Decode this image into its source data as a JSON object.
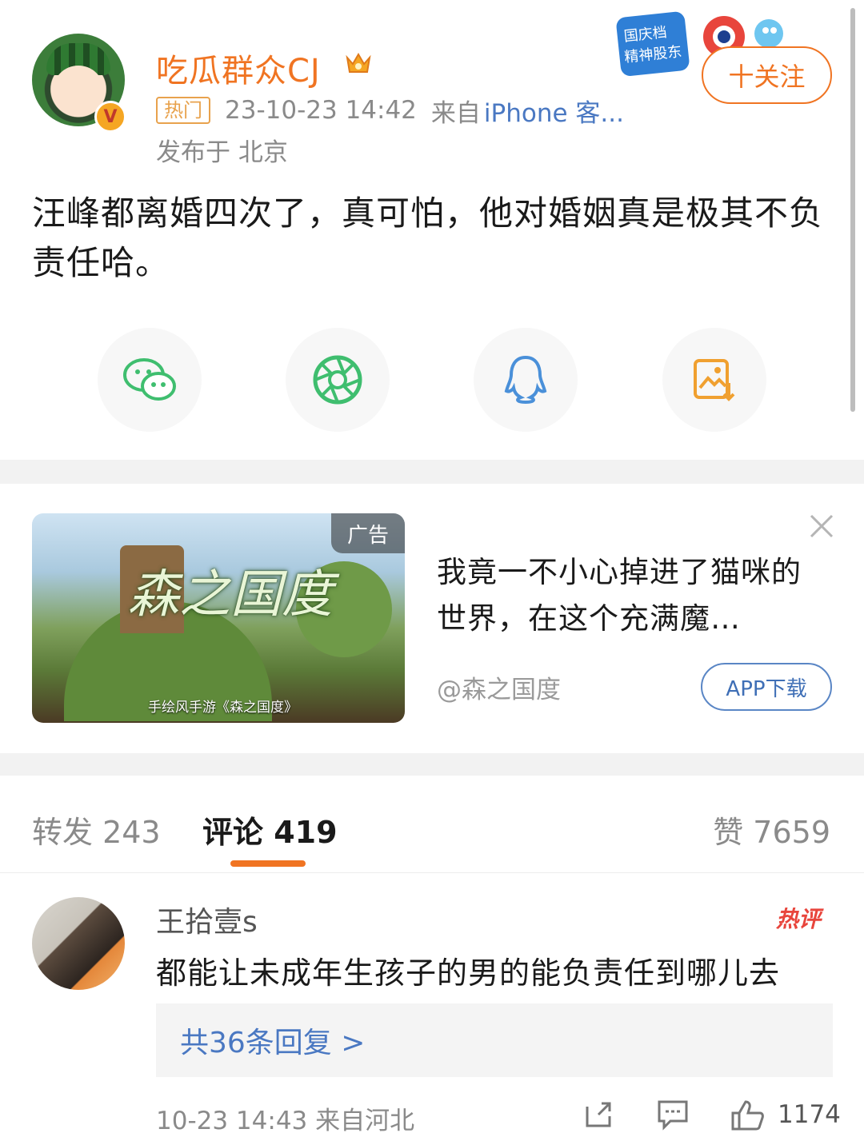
{
  "post": {
    "username": "吃瓜群众CJ",
    "hot_tag": "热门",
    "time": "23-10-23 14:42",
    "from_prefix": "来自",
    "client": "iPhone 客...",
    "location": "发布于 北京",
    "follow_label": "十关注",
    "content": "汪峰都离婚四次了，真可怕，他对婚姻真是极其不负责任哈。",
    "promo_text": "国庆档 精神股东"
  },
  "share": {
    "icons": [
      "wechat-icon",
      "moments-icon",
      "qq-icon",
      "save-image-icon"
    ]
  },
  "ad": {
    "tag": "广告",
    "image_logo": "森之国度",
    "image_caption": "手绘风手游《森之国度》",
    "title": "我竟一不小心掉进了猫咪的世界，在这个充满魔…",
    "source": "@森之国度",
    "button_label": "APP下载"
  },
  "tabs": {
    "repost": "转发 243",
    "comment": "评论 419",
    "like": "赞 7659"
  },
  "comment": {
    "username": "王拾壹s",
    "hot_label": "热评",
    "text": "都能让未成年生孩子的男的能负责任到哪儿去",
    "replies": "共36条回复 >",
    "time": "10-23 14:43  来自河北",
    "like_count": "1174"
  },
  "colors": {
    "accent": "#f07422",
    "link": "#4a78c2",
    "wechat_green": "#3fbe6f",
    "qq_blue": "#4a90d9",
    "save_orange": "#f0a030"
  }
}
